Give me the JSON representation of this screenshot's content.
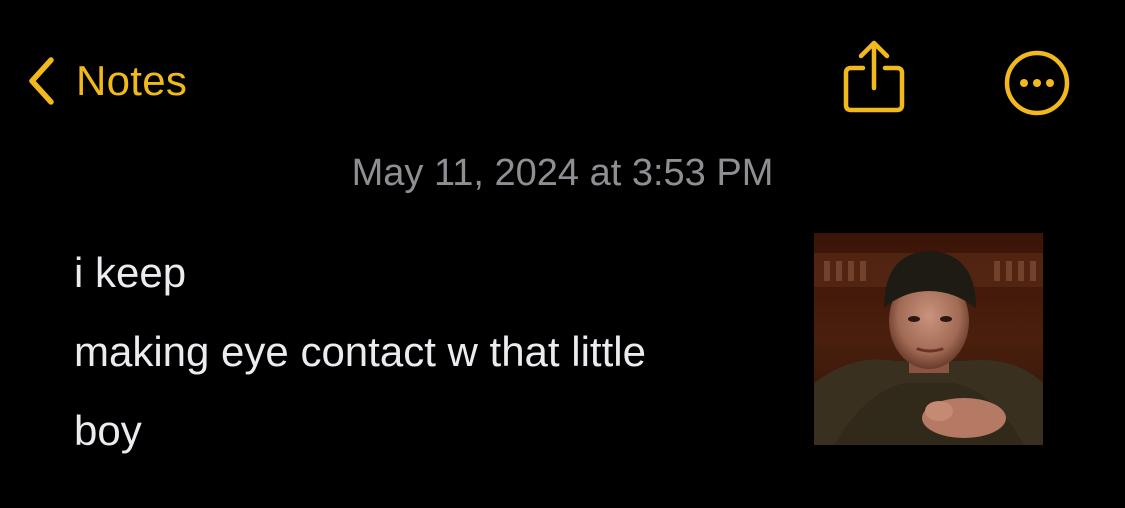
{
  "nav": {
    "back_label": "Notes",
    "accent_color": "#f2b91a",
    "back_icon": "chevron-left-icon",
    "share_icon": "share-icon",
    "more_icon": "more-icon"
  },
  "note": {
    "timestamp": "May 11, 2024 at 3:53 PM",
    "lines": [
      "i keep",
      "making eye contact w that little",
      "boy"
    ],
    "attachment_icon": "photo-attachment"
  }
}
